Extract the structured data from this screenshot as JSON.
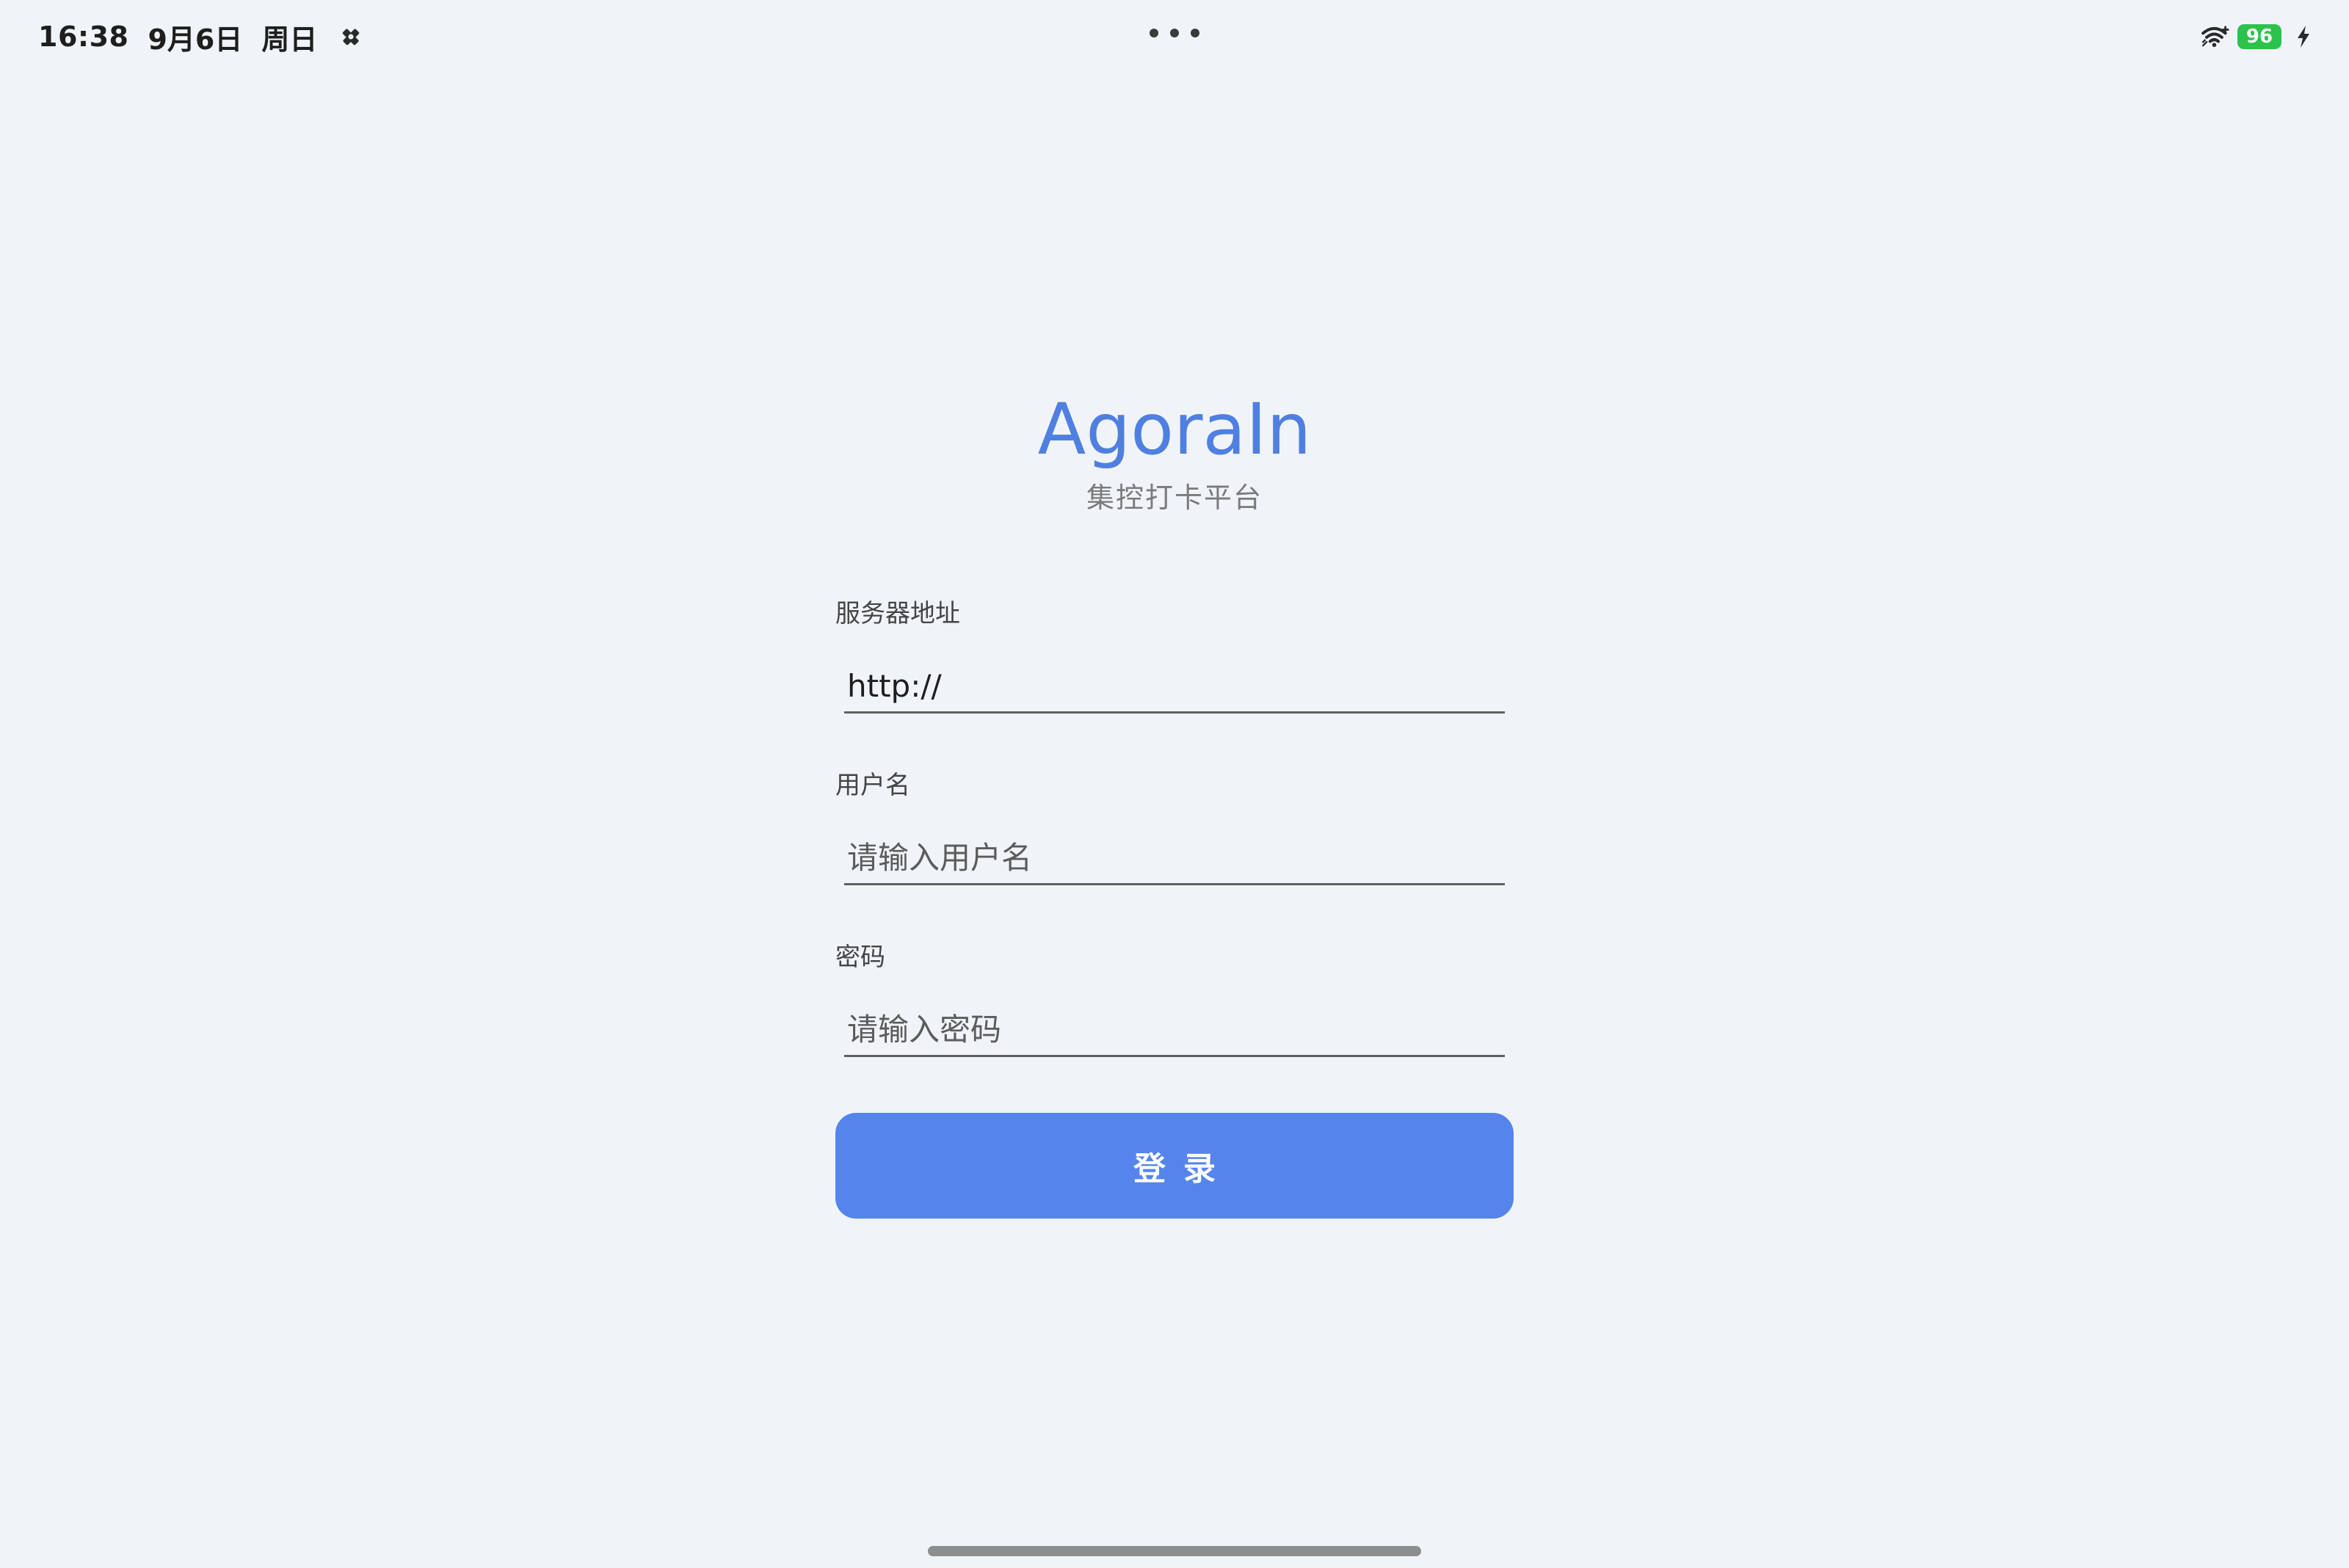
{
  "status_bar": {
    "time": "16:38",
    "date": "9月6日",
    "weekday": "周日",
    "left_icon": "notification-icon",
    "center_icon": "more-dots-icon",
    "wifi_icon": "wifi-icon",
    "battery_level": "96",
    "battery_color": "#2cc24b",
    "charging_icon": "charging-bolt-icon"
  },
  "header": {
    "title": "AgoraIn",
    "subtitle": "集控打卡平台",
    "title_color": "#4f7fe0"
  },
  "form": {
    "server": {
      "label": "服务器地址",
      "value": "http://"
    },
    "username": {
      "label": "用户名",
      "placeholder": "请输入用户名"
    },
    "password": {
      "label": "密码",
      "placeholder": "请输入密码"
    },
    "login_label": "登录",
    "button_color": "#5585ec"
  }
}
